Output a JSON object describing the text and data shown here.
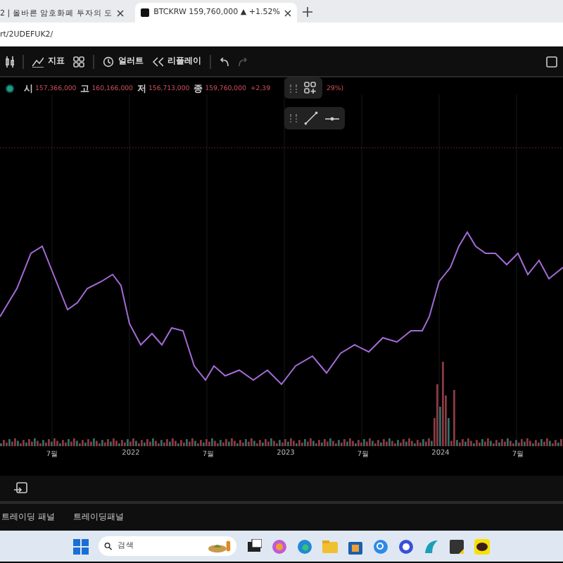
{
  "browser": {
    "tabs": [
      {
        "title": "2 | 올바른 암호화폐 투자의 도",
        "selected": false
      },
      {
        "title": "BTCKRW 159,760,000 ▲ +1.52%",
        "selected": true
      }
    ],
    "address": "rt/2UDEFUK2/"
  },
  "toolbar": {
    "buttons": [
      "지표",
      "얼러트",
      "리플레이"
    ]
  },
  "legend": {
    "items": [
      {
        "key": "시",
        "value": "157,366,000"
      },
      {
        "key": "고",
        "value": "160,166,000"
      },
      {
        "key": "저",
        "value": "156,713,000"
      },
      {
        "key": "종",
        "value": "159,760,000"
      }
    ],
    "change": "+2,39",
    "change_tail": "29%)"
  },
  "x_axis": {
    "labels": [
      "7월",
      "2022",
      "7월",
      "2023",
      "7월",
      "2024",
      "7월"
    ]
  },
  "panel_tabs": [
    "트레이딩 패널",
    "트레이딩패널"
  ],
  "taskbar": {
    "search": {
      "placeholder": "검색"
    }
  }
}
